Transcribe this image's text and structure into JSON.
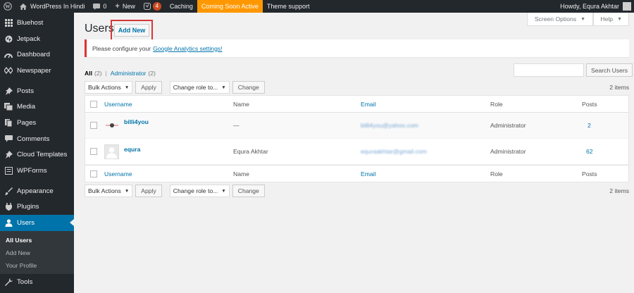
{
  "adminbar": {
    "site_name": "WordPress In Hindi",
    "comments_count": "0",
    "new_label": "New",
    "updates_count": "4",
    "caching_label": "Caching",
    "coming_soon_label": "Coming Soon Active",
    "theme_support_label": "Theme support",
    "howdy_label": "Howdy, Equra Akhtar",
    "coming_soon_color": "#ff9800",
    "bar_color": "#23282d"
  },
  "sidebar": {
    "items": [
      {
        "label": "Bluehost",
        "icon": "grid-icon"
      },
      {
        "label": "Jetpack",
        "icon": "jetpack-icon"
      },
      {
        "label": "Dashboard",
        "icon": "dashboard-icon"
      },
      {
        "label": "Newspaper",
        "icon": "newspaper-icon"
      },
      {
        "label": "Posts",
        "icon": "pin-icon"
      },
      {
        "label": "Media",
        "icon": "media-icon"
      },
      {
        "label": "Pages",
        "icon": "pages-icon"
      },
      {
        "label": "Comments",
        "icon": "comment-icon"
      },
      {
        "label": "Cloud Templates",
        "icon": "pin-icon"
      },
      {
        "label": "WPForms",
        "icon": "forms-icon"
      },
      {
        "label": "Appearance",
        "icon": "brush-icon"
      },
      {
        "label": "Plugins",
        "icon": "plug-icon"
      },
      {
        "label": "Users",
        "icon": "user-icon"
      }
    ],
    "submenu": [
      "All Users",
      "Add New",
      "Your Profile"
    ],
    "tools_label": "Tools",
    "accent": "#0073aa"
  },
  "header": {
    "screen_options": "Screen Options",
    "help": "Help",
    "title": "Users",
    "add_new": "Add New"
  },
  "notice": {
    "text": "Please configure your",
    "link": "Google Analytics settings!"
  },
  "filters": {
    "all_label": "All",
    "all_count": "(2)",
    "admin_label": "Administrator",
    "admin_count": "(2)"
  },
  "search": {
    "button": "Search Users",
    "placeholder": ""
  },
  "tablenav": {
    "bulk_actions": "Bulk Actions",
    "apply": "Apply",
    "change_role": "Change role to...",
    "change": "Change",
    "items_count": "2 items"
  },
  "table": {
    "columns": [
      "Username",
      "Name",
      "Email",
      "Role",
      "Posts"
    ],
    "rows": [
      {
        "username": "billi4you",
        "name": "—",
        "email": "billi4you@yahoo.com",
        "role": "Administrator",
        "posts": "2"
      },
      {
        "username": "equra",
        "name": "Equra Akhtar",
        "email": "equraakhtar@gmail.com",
        "role": "Administrator",
        "posts": "62"
      }
    ]
  }
}
